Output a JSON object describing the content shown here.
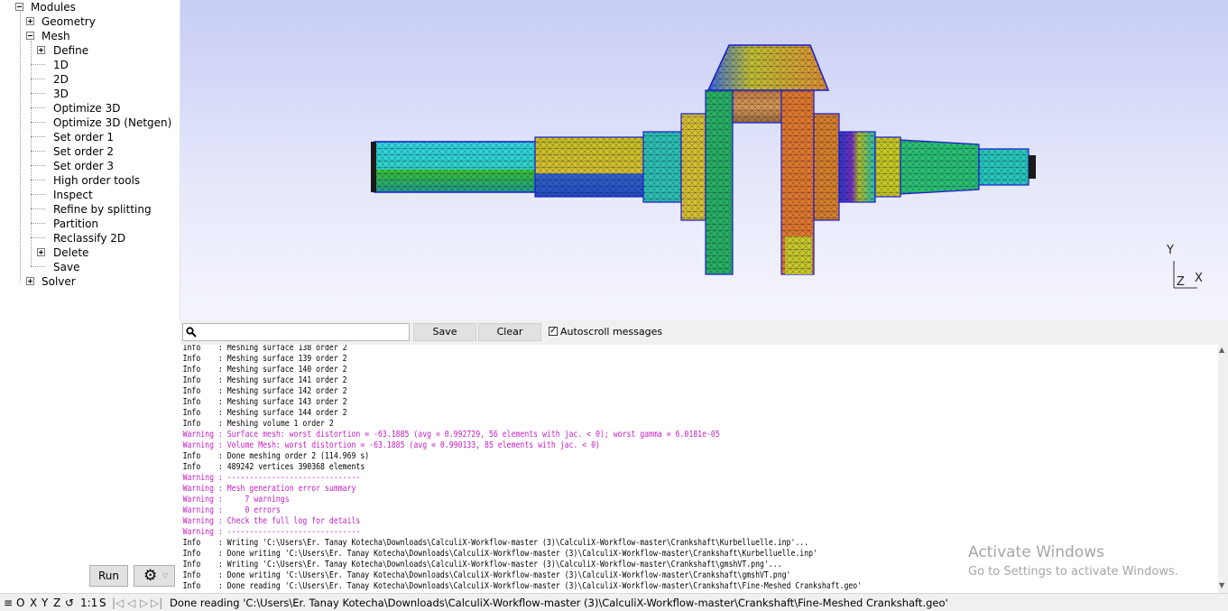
{
  "tree": {
    "modules": "Modules",
    "geometry": "Geometry",
    "mesh": "Mesh",
    "define": "Define",
    "d1": "1D",
    "d2": "2D",
    "d3": "3D",
    "optimize3d": "Optimize 3D",
    "optimize3d_netgen": "Optimize 3D (Netgen)",
    "order1": "Set order 1",
    "order2": "Set order 2",
    "order3": "Set order 3",
    "high_order": "High order tools",
    "inspect": "Inspect",
    "refine": "Refine by splitting",
    "partition": "Partition",
    "reclassify": "Reclassify 2D",
    "delete": "Delete",
    "save": "Save",
    "solver": "Solver"
  },
  "controls": {
    "run_label": "Run",
    "gear_icon": "gear-icon"
  },
  "axes": {
    "y": "Y",
    "z": "Z",
    "x": "X"
  },
  "toolbar": {
    "search_placeholder": "",
    "save_label": "Save",
    "clear_label": "Clear",
    "autoscroll_label": "Autoscroll messages",
    "autoscroll_checked": true
  },
  "log": [
    {
      "type": "info",
      "text": "Info    : Meshing surface 138 order 2"
    },
    {
      "type": "info",
      "text": "Info    : Meshing surface 139 order 2"
    },
    {
      "type": "info",
      "text": "Info    : Meshing surface 140 order 2"
    },
    {
      "type": "info",
      "text": "Info    : Meshing surface 141 order 2"
    },
    {
      "type": "info",
      "text": "Info    : Meshing surface 142 order 2"
    },
    {
      "type": "info",
      "text": "Info    : Meshing surface 143 order 2"
    },
    {
      "type": "info",
      "text": "Info    : Meshing surface 144 order 2"
    },
    {
      "type": "info",
      "text": "Info    : Meshing volume 1 order 2"
    },
    {
      "type": "warn",
      "text": "Warning : Surface mesh: worst distortion = -63.1885 (avg = 0.992729, 56 elements with jac. < 0); worst gamma = 6.0181e-05"
    },
    {
      "type": "warn",
      "text": "Warning : Volume Mesh: worst distortion = -63.1885 (avg = 0.990133, 85 elements with jac. < 0)"
    },
    {
      "type": "info",
      "text": "Info    : Done meshing order 2 (114.969 s)"
    },
    {
      "type": "info",
      "text": "Info    : 489242 vertices 390368 elements"
    },
    {
      "type": "warn",
      "text": "Warning : ------------------------------"
    },
    {
      "type": "warn",
      "text": "Warning : Mesh generation error summary"
    },
    {
      "type": "warn",
      "text": "Warning :     7 warnings"
    },
    {
      "type": "warn",
      "text": "Warning :     0 errors"
    },
    {
      "type": "warn",
      "text": "Warning : Check the full log for details"
    },
    {
      "type": "warn",
      "text": "Warning : ------------------------------"
    },
    {
      "type": "info",
      "text": "Info    : Writing 'C:\\Users\\Er. Tanay Kotecha\\Downloads\\CalculiX-Workflow-master (3)\\CalculiX-Workflow-master\\Crankshaft\\Kurbelluelle.inp'..."
    },
    {
      "type": "info",
      "text": "Info    : Done writing 'C:\\Users\\Er. Tanay Kotecha\\Downloads\\CalculiX-Workflow-master (3)\\CalculiX-Workflow-master\\Crankshaft\\Kurbelluelle.inp'"
    },
    {
      "type": "info",
      "text": "Info    : Writing 'C:\\Users\\Er. Tanay Kotecha\\Downloads\\CalculiX-Workflow-master (3)\\CalculiX-Workflow-master\\Crankshaft\\gmshVT.png'..."
    },
    {
      "type": "info",
      "text": "Info    : Done writing 'C:\\Users\\Er. Tanay Kotecha\\Downloads\\CalculiX-Workflow-master (3)\\CalculiX-Workflow-master\\Crankshaft\\gmshVT.png'"
    },
    {
      "type": "info",
      "text": "Info    : Done reading 'C:\\Users\\Er. Tanay Kotecha\\Downloads\\CalculiX-Workflow-master (3)\\CalculiX-Workflow-master\\Crankshaft\\Fine-Meshed Crankshaft.geo'"
    }
  ],
  "watermark": {
    "line1": "Activate Windows",
    "line2": "Go to Settings to activate Windows."
  },
  "statusbar": {
    "menu": "≡",
    "o": "O",
    "x": "X",
    "y": "Y",
    "z": "Z",
    "rotate": "↺",
    "scale": "1:1",
    "s": "S",
    "first": "|◁",
    "prev": "◁",
    "next": "▷",
    "last": "▷|",
    "message": "Done reading 'C:\\Users\\Er. Tanay Kotecha\\Downloads\\CalculiX-Workflow-master (3)\\CalculiX-Workflow-master\\Crankshaft\\Fine-Meshed Crankshaft.geo'"
  },
  "colors": {
    "warning": "#c41fc4",
    "mesh_edge": "#1a1ad0",
    "viewport_top": "#c7cdf5",
    "viewport_bottom": "#f4f5fd"
  }
}
